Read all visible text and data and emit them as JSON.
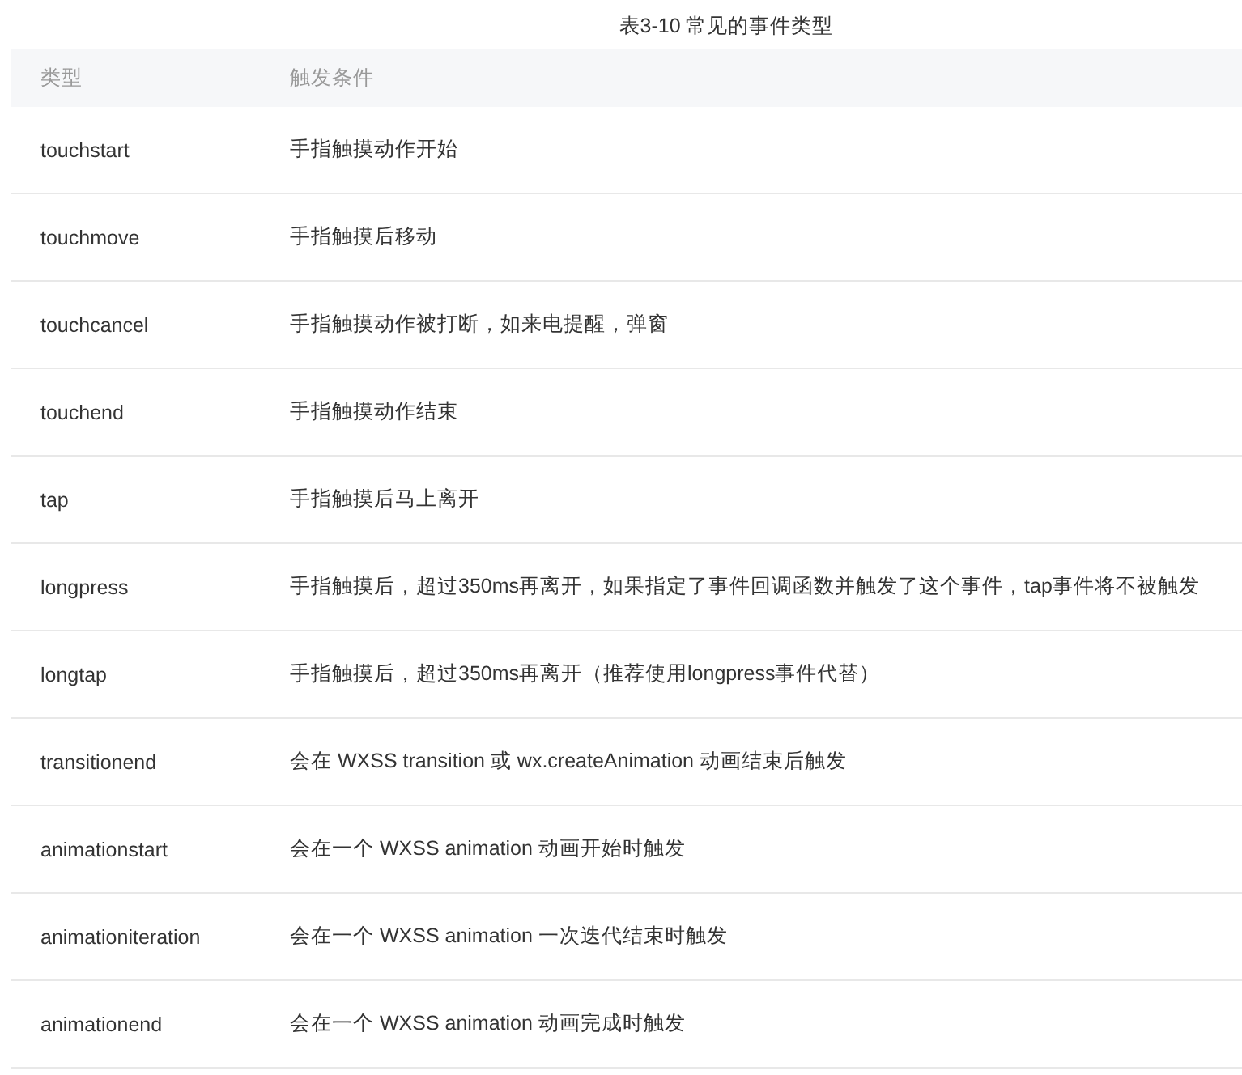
{
  "caption": "表3-10 常见的事件类型",
  "table": {
    "columns": [
      "类型",
      "触发条件"
    ],
    "rows": [
      [
        "touchstart",
        "手指触摸动作开始"
      ],
      [
        "touchmove",
        "手指触摸后移动"
      ],
      [
        "touchcancel",
        "手指触摸动作被打断，如来电提醒，弹窗"
      ],
      [
        "touchend",
        "手指触摸动作结束"
      ],
      [
        "tap",
        "手指触摸后马上离开"
      ],
      [
        "longpress",
        "手指触摸后，超过350ms再离开，如果指定了事件回调函数并触发了这个事件，tap事件将不被触发"
      ],
      [
        "longtap",
        "手指触摸后，超过350ms再离开（推荐使用longpress事件代替）"
      ],
      [
        "transitionend",
        "会在 WXSS transition 或 wx.createAnimation 动画结束后触发"
      ],
      [
        "animationstart",
        "会在一个 WXSS animation 动画开始时触发"
      ],
      [
        "animationiteration",
        "会在一个 WXSS animation 一次迭代结束时触发"
      ],
      [
        "animationend",
        "会在一个 WXSS animation 动画完成时触发"
      ]
    ]
  }
}
